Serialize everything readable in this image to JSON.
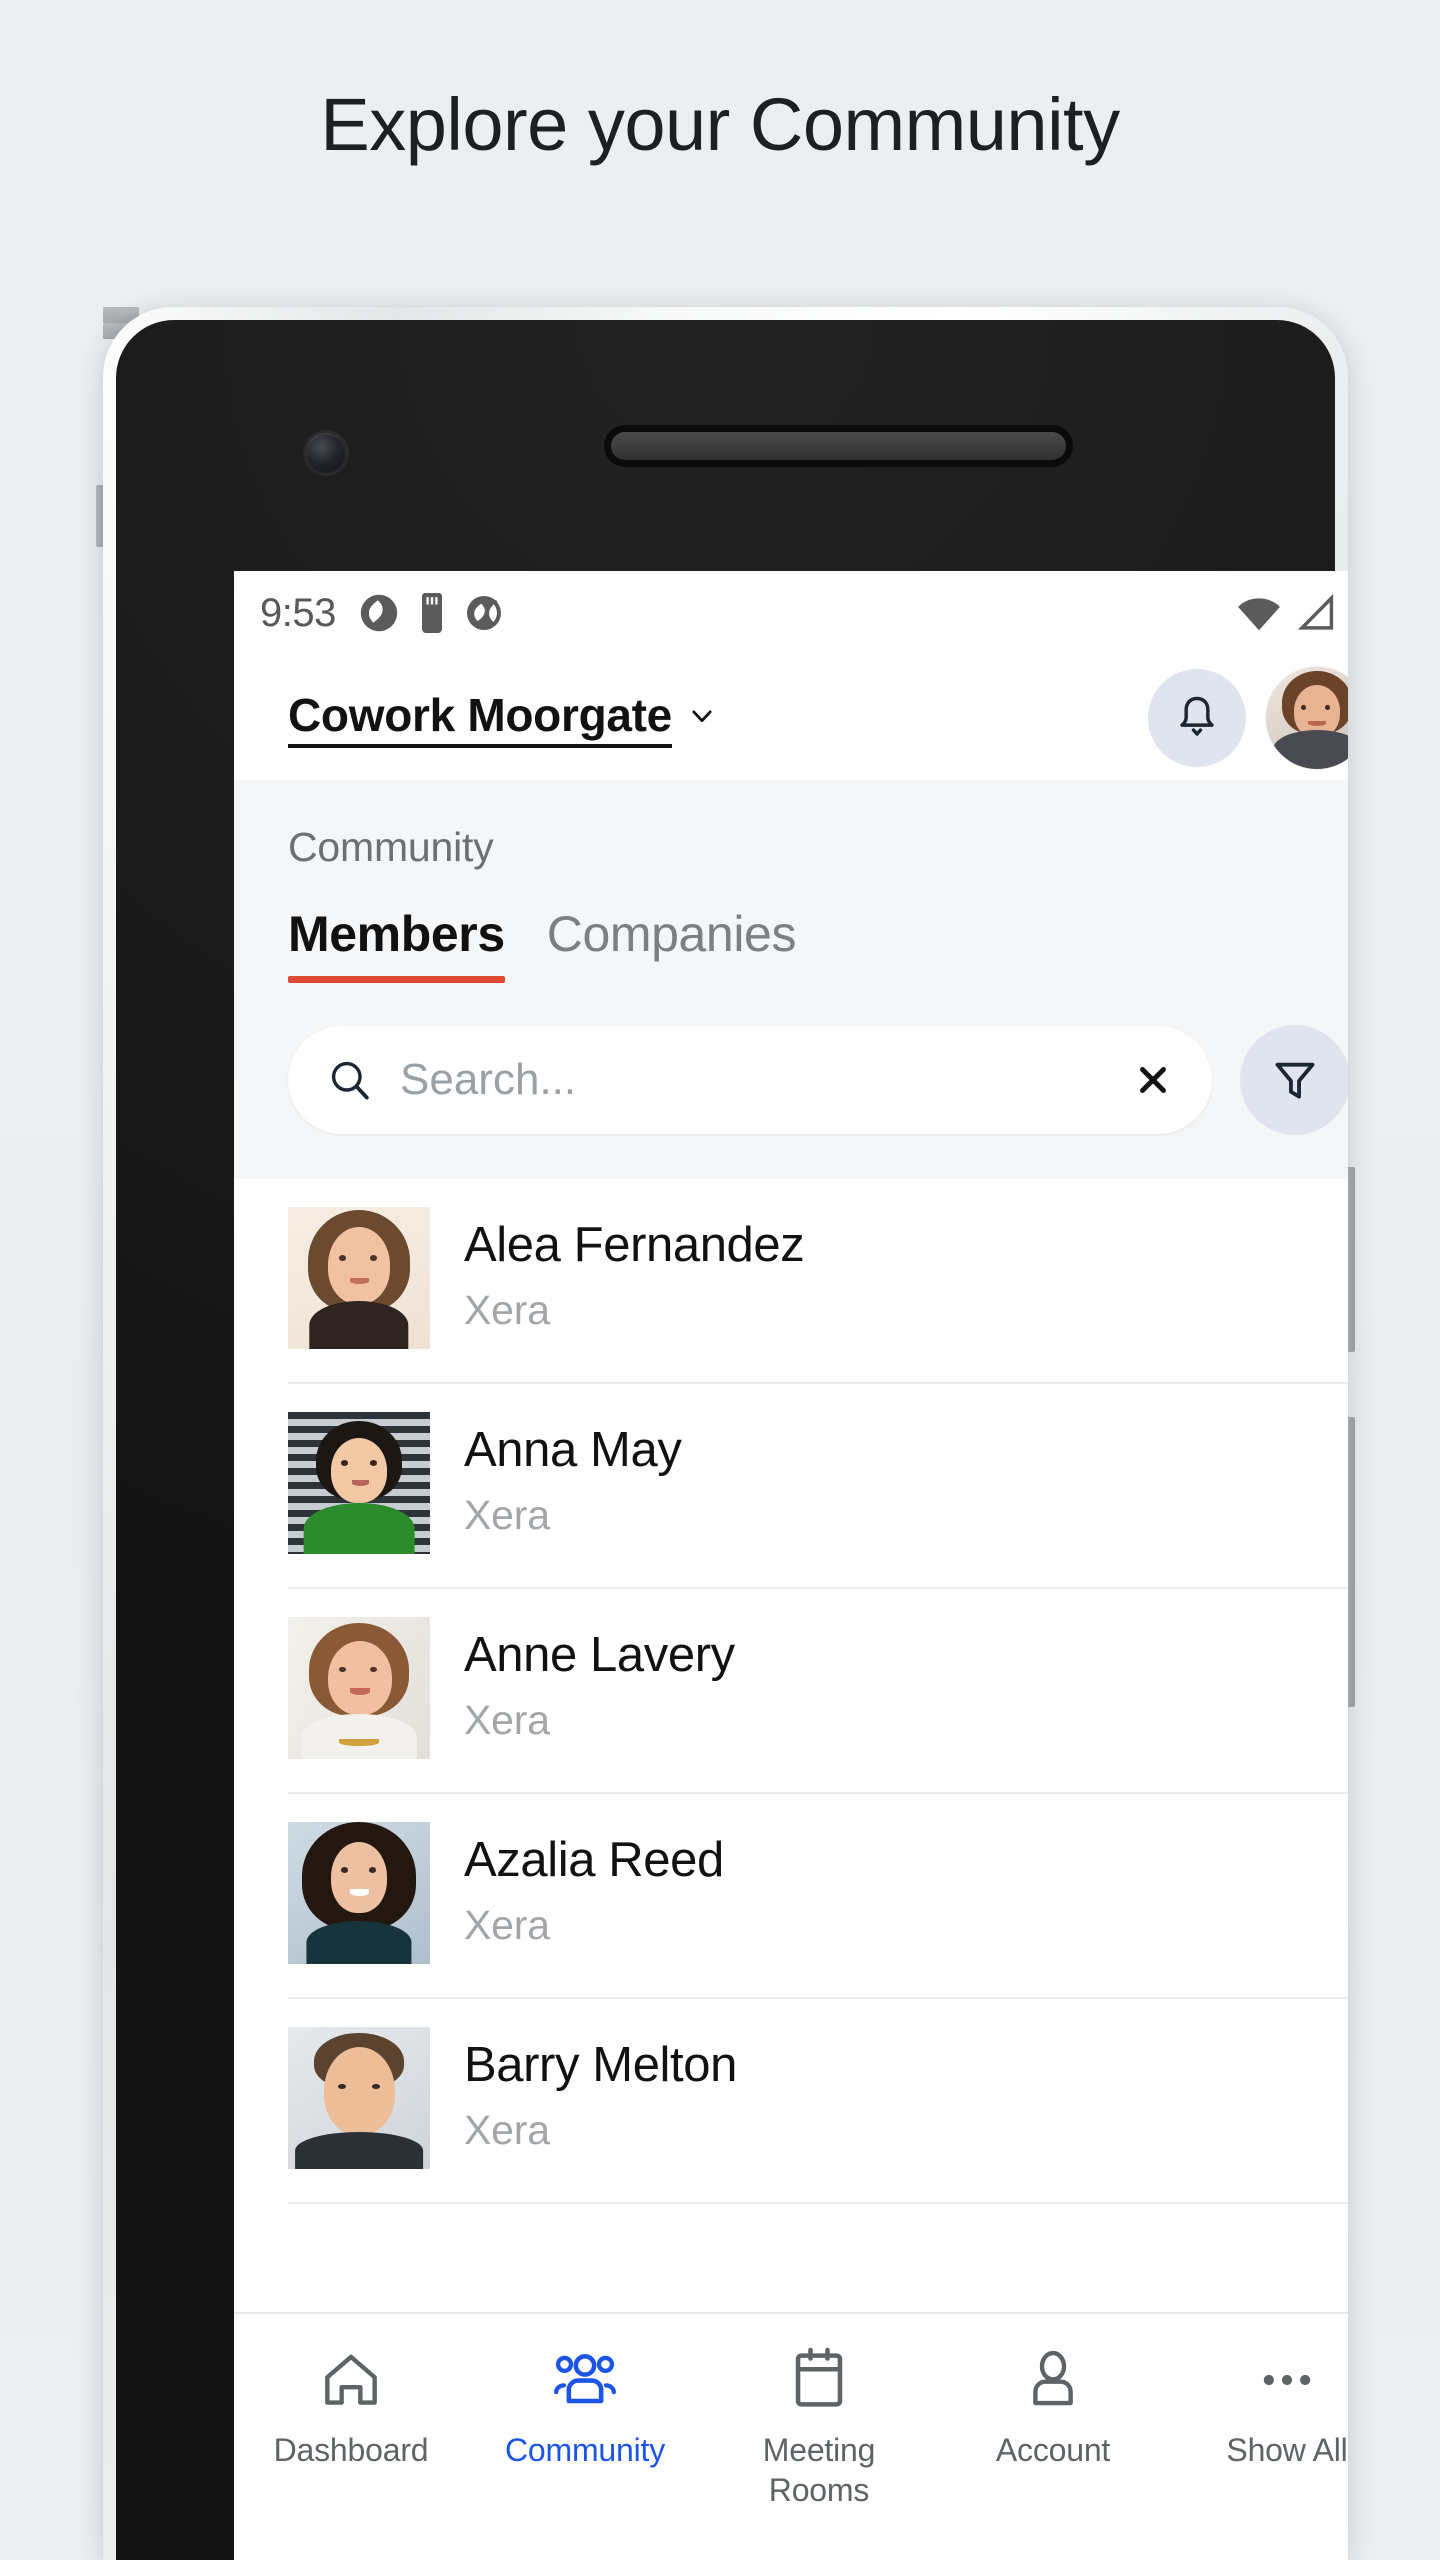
{
  "hero": {
    "title": "Explore your Community"
  },
  "statusbar": {
    "time": "9:53",
    "left_icons": [
      "sync-icon",
      "sd-card-icon",
      "vpn-icon"
    ],
    "right_icons": [
      "wifi-icon",
      "cellular-signal-icon",
      "battery-charging-icon"
    ]
  },
  "header": {
    "venue_name": "Cowork Moorgate",
    "venue_chevron": "chevron-down-icon",
    "notifications_icon": "bell-icon",
    "avatar": "user-avatar"
  },
  "page": {
    "section_title": "Community",
    "tabs": [
      {
        "label": "Members",
        "active": true
      },
      {
        "label": "Companies",
        "active": false
      }
    ]
  },
  "search": {
    "placeholder": "Search...",
    "value": "",
    "search_icon": "search-icon",
    "clear_icon": "close-icon",
    "filter_icon": "filter-funnel-icon"
  },
  "members": [
    {
      "name": "Alea Fernandez",
      "company": "Xera"
    },
    {
      "name": "Anna May",
      "company": "Xera"
    },
    {
      "name": "Anne Lavery",
      "company": "Xera"
    },
    {
      "name": "Azalia Reed",
      "company": "Xera"
    },
    {
      "name": "Barry Melton",
      "company": "Xera"
    }
  ],
  "bottom_nav": [
    {
      "label": "Dashboard",
      "icon": "home-icon",
      "active": false
    },
    {
      "label": "Community",
      "icon": "people-icon",
      "active": true
    },
    {
      "label": "Meeting\nRooms",
      "icon": "calendar-icon",
      "active": false
    },
    {
      "label": "Account",
      "icon": "person-icon",
      "active": false
    },
    {
      "label": "Show All",
      "icon": "ellipsis-icon",
      "active": false
    }
  ],
  "colors": {
    "page_background": "#eceff1",
    "accent_tab_underline": "#dd4b34",
    "accent_nav_active": "#1c55e6",
    "subheader_background": "#f4f6f8",
    "icon_button_background": "#dfe4ee",
    "muted_text": "#a2a6a9"
  }
}
